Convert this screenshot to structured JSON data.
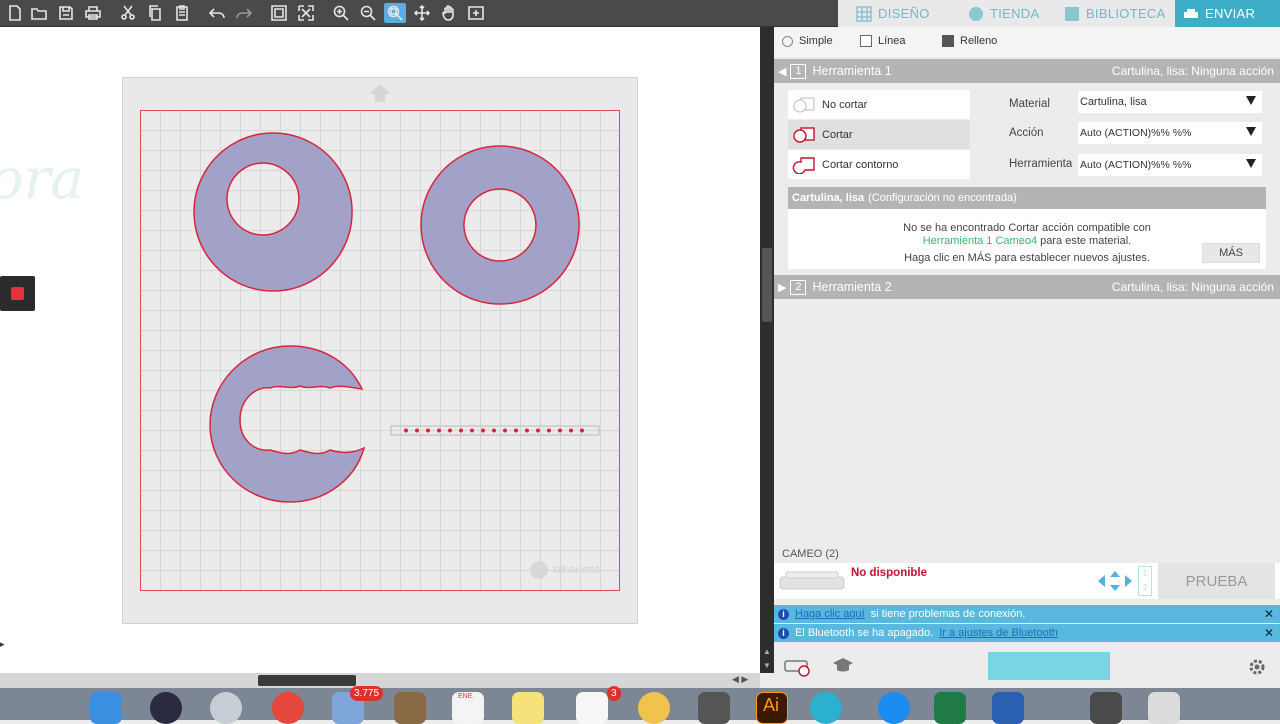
{
  "toolbar": {
    "icons": [
      "new-document",
      "open-folder",
      "save",
      "print",
      "cut",
      "copy",
      "paste",
      "undo",
      "redo",
      "group",
      "ungroup",
      "zoom-in",
      "zoom-out",
      "zoom-select",
      "move",
      "pan",
      "add-page"
    ]
  },
  "nav": {
    "design": "DISEÑO",
    "store": "TIENDA",
    "library": "BIBLIOTECA",
    "send": "ENVIAR"
  },
  "modes": {
    "simple": "Simple",
    "line": "Línea",
    "fill": "Relleno"
  },
  "tool1": {
    "number": "1",
    "title": "Herramienta 1",
    "status": "Cartulina, lisa: Ninguna acción",
    "options": {
      "no_cut": "No cortar",
      "cut": "Cortar",
      "cut_outline": "Cortar contorno"
    },
    "material_label": "Material",
    "material_value": "Cartulina, lisa",
    "action_label": "Acción",
    "action_value": "Auto (ACTION)%% %%",
    "tool_label": "Herramienta",
    "tool_value": "Auto (ACTION)%% %%",
    "warning_title": "Cartulina, lisa",
    "warning_note": "(Configuración no encontrada)",
    "msg_line1": "No se ha encontrado Cortar acción compatible con",
    "msg_link": "Herramienta 1 Cameo4",
    "msg_line2_suffix": "para este material.",
    "msg_line3": "Haga clic en MÁS para establecer nuevos ajustes.",
    "more_button": "MÁS"
  },
  "tool2": {
    "number": "2",
    "title": "Herramienta 2",
    "status": "Cartulina, lisa: Ninguna acción"
  },
  "device": {
    "section": "CAMEO (2)",
    "status": "No disponible",
    "test_button": "PRUEBA"
  },
  "notices": {
    "connection_link": "Haga clic aquí",
    "connection_text": "si tiene problemas de conexión.",
    "bluetooth_text": "El Bluetooth se ha apagado.",
    "bluetooth_link": "Ir a ajustes de Bluetooth"
  },
  "workspace": {
    "watermark": "silhouette"
  },
  "dock": {
    "mail_badge": "3.775",
    "calendar_month": "ENE.",
    "reminders_badge": "3"
  },
  "colors": {
    "accent": "#3eaec8",
    "shape_fill": "#a2a2c8",
    "cut_line": "#d9243c",
    "info_bar": "#58b8df",
    "error_text": "#c8102e"
  }
}
